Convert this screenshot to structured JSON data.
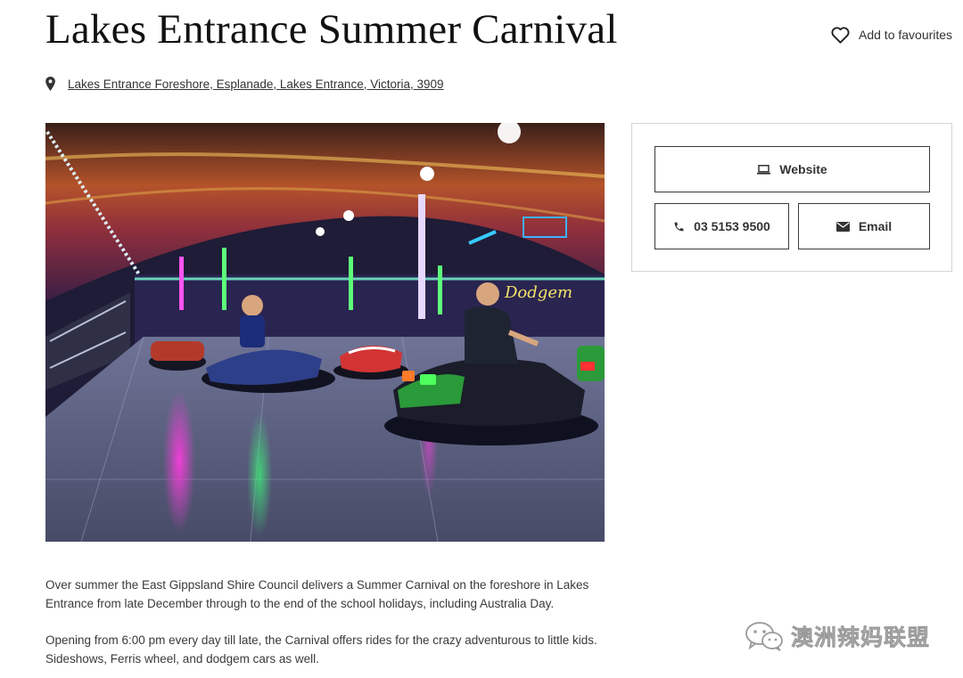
{
  "header": {
    "title": "Lakes Entrance Summer Carnival",
    "favourite_label": "Add to favourites",
    "favourite_icon": "heart-outline-icon"
  },
  "location": {
    "icon": "map-pin-icon",
    "address": "Lakes Entrance Foreshore, Esplanade, Lakes Entrance, Victoria, 3909"
  },
  "hero_image": {
    "subject": "bumper-cars-photo"
  },
  "contact": {
    "website_label": "Website",
    "website_icon": "laptop-icon",
    "phone_label": "03 5153 9500",
    "phone_icon": "phone-icon",
    "email_label": "Email",
    "email_icon": "envelope-icon"
  },
  "description": {
    "paragraph_1": "Over summer the East Gippsland Shire Council delivers a Summer Carnival on the foreshore in Lakes Entrance from late December through to the end of the school holidays, including Australia Day.",
    "paragraph_2": "Opening from 6:00 pm every day till late, the Carnival offers rides for the crazy adventurous to little kids. Sideshows, Ferris wheel, and dodgem cars as well."
  },
  "watermark": {
    "text": "澳洲辣妈联盟",
    "icon": "wechat-icon"
  },
  "colors": {
    "text_dark": "#111111",
    "border": "#3a3a3a",
    "box_border": "#d5d5d5"
  }
}
